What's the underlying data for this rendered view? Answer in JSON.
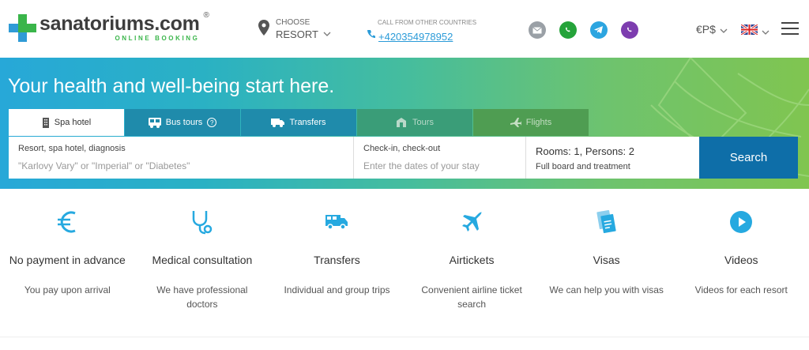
{
  "header": {
    "logo": {
      "name": "sanatoriums.com",
      "reg": "®",
      "sub": "ONLINE BOOKING"
    },
    "resort": {
      "label": "CHOOSE",
      "value": "RESORT"
    },
    "phone": {
      "label": "CALL FROM OTHER COUNTRIES",
      "number": "+420354978952"
    },
    "messengers": [
      {
        "name": "email",
        "color": "#9aa0a6"
      },
      {
        "name": "whatsapp",
        "color": "#25a33a"
      },
      {
        "name": "telegram",
        "color": "#2ca5e0"
      },
      {
        "name": "viber",
        "color": "#7d3daf"
      }
    ],
    "currency": "€P$"
  },
  "hero": {
    "title": "Your health and well-being start here.",
    "tabs": [
      {
        "label": "Spa hotel",
        "icon": "building-icon"
      },
      {
        "label": "Bus tours",
        "icon": "bus-icon"
      },
      {
        "label": "Transfers",
        "icon": "van-icon"
      },
      {
        "label": "Tours",
        "icon": "tours-icon"
      },
      {
        "label": "Flights",
        "icon": "plane-icon"
      }
    ],
    "search": {
      "destination_label": "Resort, spa hotel, diagnosis",
      "destination_placeholder": "\"Karlovy Vary\" or \"Imperial\" or \"Diabetes\"",
      "dates_label": "Check-in, check-out",
      "dates_placeholder": "Enter the dates of your stay",
      "rooms": "Rooms: 1, Persons: 2",
      "board": "Full board and treatment",
      "button": "Search"
    }
  },
  "features": [
    {
      "title": "No payment in advance",
      "desc": "You pay upon arrival",
      "icon": "euro-icon"
    },
    {
      "title": "Medical consultation",
      "desc": "We have professional doctors",
      "icon": "stethoscope-icon"
    },
    {
      "title": "Transfers",
      "desc": "Individual and group trips",
      "icon": "van-icon"
    },
    {
      "title": "Airtickets",
      "desc": "Convenient airline ticket search",
      "icon": "plane-icon"
    },
    {
      "title": "Visas",
      "desc": "We can help you with visas",
      "icon": "passport-icon"
    },
    {
      "title": "Videos",
      "desc": "Videos for each resort",
      "icon": "play-icon"
    }
  ],
  "colors": {
    "brand_green": "#3ab54a",
    "accent_blue": "#26a9e0",
    "button_blue": "#0e6ea8"
  }
}
